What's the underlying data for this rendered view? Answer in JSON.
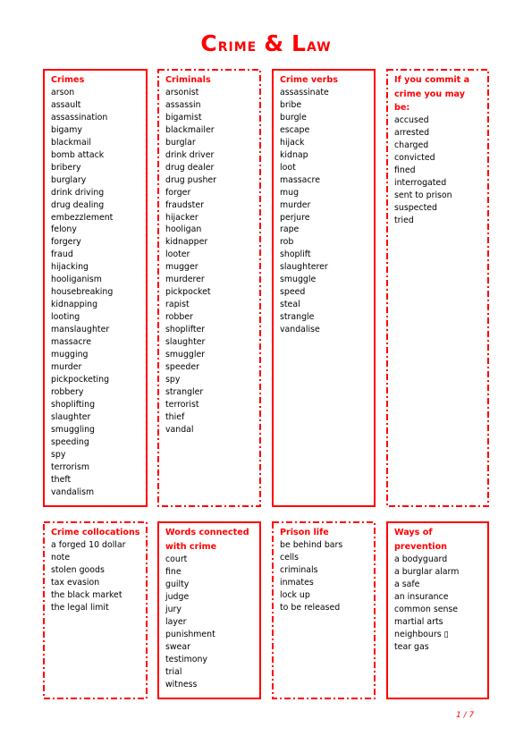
{
  "title": "Crime & Law",
  "page_number": "1 / 7",
  "accent_color": "#ff0000",
  "boxes": [
    {
      "heading": "Crimes",
      "border": "solid",
      "items": [
        "arson",
        "assault",
        "assassination",
        "bigamy",
        "blackmail",
        "bomb attack",
        "bribery",
        "burglary",
        "drink driving",
        "drug dealing",
        "embezzlement",
        "felony",
        "forgery",
        "fraud",
        "hijacking",
        "hooliganism",
        "housebreaking",
        "kidnapping",
        "looting",
        "manslaughter",
        "massacre",
        "mugging",
        "murder",
        "pickpocketing",
        "robbery",
        "shoplifting",
        "slaughter",
        "smuggling",
        "speeding",
        "spy",
        "terrorism",
        "theft",
        "vandalism"
      ]
    },
    {
      "heading": "Criminals",
      "border": "dash-dot",
      "items": [
        "arsonist",
        "assassin",
        "bigamist",
        "blackmailer",
        "burglar",
        "drink driver",
        "drug dealer",
        "drug pusher",
        "forger",
        "fraudster",
        "hijacker",
        "hooligan",
        "kidnapper",
        "looter",
        "mugger",
        "murderer",
        "pickpocket",
        "rapist",
        "robber",
        "shoplifter",
        "slaughter",
        "smuggler",
        "speeder",
        "spy",
        "strangler",
        "terrorist",
        "thief",
        "vandal"
      ]
    },
    {
      "heading": "Crime verbs",
      "border": "solid",
      "items": [
        "assassinate",
        "bribe",
        "burgle",
        "escape",
        "hijack",
        "kidnap",
        "loot",
        "massacre",
        "mug",
        "murder",
        "perjure",
        "rape",
        "rob",
        "shoplift",
        "slaughterer",
        "smuggle",
        "speed",
        "steal",
        "strangle",
        "vandalise"
      ]
    },
    {
      "heading_lines": [
        "If you commit a",
        "crime you may be:"
      ],
      "border": "dash-dot",
      "items": [
        "accused",
        "arrested",
        "charged",
        "convicted",
        "fined",
        "interrogated",
        "sent to prison",
        "suspected",
        "tried"
      ]
    },
    {
      "heading": "Crime collocations",
      "border": "dash-dot",
      "items": [
        "a forged 10 dollar",
        "note",
        "stolen goods",
        "tax evasion",
        "the black market",
        "the legal limit"
      ]
    },
    {
      "heading_lines": [
        "Words connected",
        "with crime"
      ],
      "border": "solid",
      "items": [
        "court",
        "fine",
        "guilty",
        "judge",
        "jury",
        "layer",
        "punishment",
        "swear",
        "testimony",
        "trial",
        "witness"
      ]
    },
    {
      "heading": "Prison life",
      "border": "dash-dot",
      "items": [
        "be behind bars",
        "cells",
        "criminals",
        "inmates",
        "lock up",
        "to be released"
      ]
    },
    {
      "heading_lines": [
        "Ways of",
        "prevention"
      ],
      "border": "solid",
      "items": [
        "a bodyguard",
        "a burglar alarm",
        "a safe",
        "an insurance",
        "common sense",
        "martial arts",
        "neighbours ▯",
        "tear gas"
      ]
    }
  ]
}
